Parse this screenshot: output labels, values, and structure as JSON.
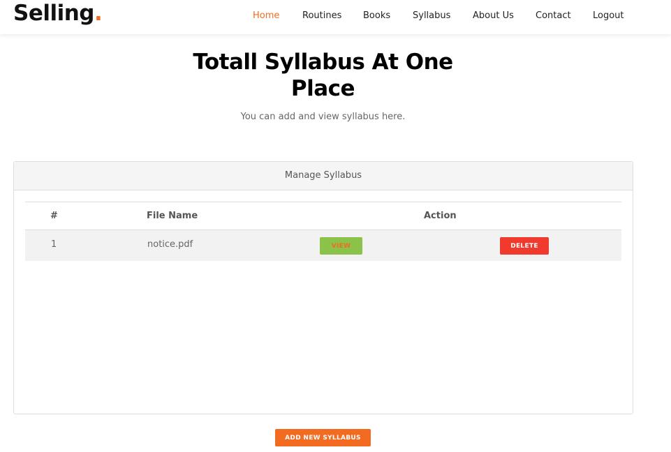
{
  "brand": {
    "name": "Selling",
    "dot": "."
  },
  "nav": {
    "items": [
      {
        "label": "Home",
        "active": true
      },
      {
        "label": "Routines",
        "active": false
      },
      {
        "label": "Books",
        "active": false
      },
      {
        "label": "Syllabus",
        "active": false
      },
      {
        "label": "About Us",
        "active": false
      },
      {
        "label": "Contact",
        "active": false
      },
      {
        "label": "Logout",
        "active": false
      }
    ]
  },
  "hero": {
    "title_line1": "Totall Syllabus At One",
    "title_line2": "Place",
    "subtitle": "You can add and view syllabus here."
  },
  "panel": {
    "heading": "Manage Syllabus",
    "columns": {
      "index": "#",
      "file_name": "File Name",
      "action": "Action"
    },
    "rows": [
      {
        "index": "1",
        "file_name": "notice.pdf",
        "view_label": "VIEW",
        "delete_label": "DELETE"
      }
    ]
  },
  "add_button": {
    "label": "ADD NEW SYLLABUS"
  },
  "colors": {
    "accent": "#f26b21",
    "view_button": "#8bc34a",
    "delete_button": "#f03a2e"
  }
}
